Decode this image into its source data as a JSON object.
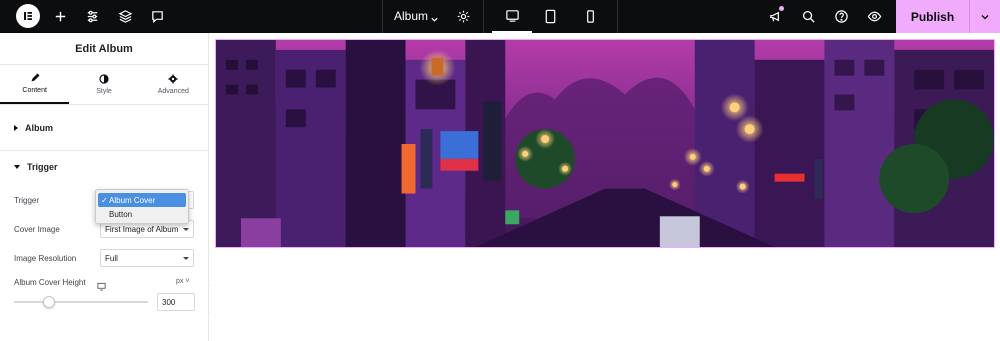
{
  "topbar": {
    "doc_title": "Album",
    "publish_label": "Publish",
    "icons": [
      "elementor-logo-icon",
      "plus-icon",
      "sliders-icon",
      "layers-icon",
      "chat-icon",
      "gear-icon",
      "desktop-icon",
      "tablet-icon",
      "mobile-icon",
      "announcement-icon",
      "search-icon",
      "help-icon",
      "eye-icon",
      "chevron-down-icon"
    ],
    "accent": "#f0abfc"
  },
  "panel": {
    "title": "Edit Album",
    "tabs": [
      {
        "label": "Content",
        "icon": "pencil-icon"
      },
      {
        "label": "Style",
        "icon": "half-circle-icon"
      },
      {
        "label": "Advanced",
        "icon": "gear-icon"
      }
    ],
    "sections": {
      "album": "Album",
      "trigger": "Trigger"
    },
    "controls": {
      "trigger_label": "Trigger",
      "cover_image_label": "Cover Image",
      "cover_image_value": "First Image of Album",
      "image_resolution_label": "Image Resolution",
      "image_resolution_value": "Full",
      "album_cover_height_label": "Album Cover Height",
      "unit": "px",
      "height_value": "300",
      "slider_fraction": 0.26
    },
    "trigger_dropdown": {
      "options": [
        "Album Cover",
        "Button"
      ],
      "selected": "Album Cover",
      "check": "✓"
    }
  }
}
